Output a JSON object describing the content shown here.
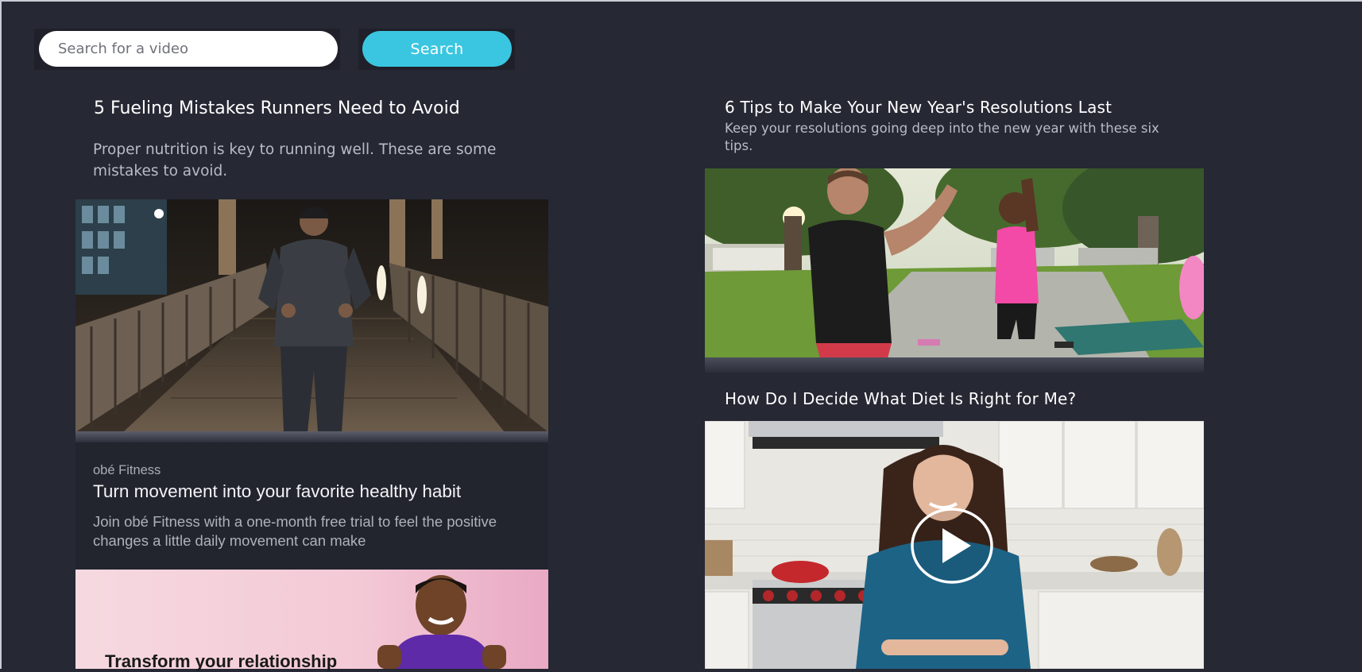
{
  "search": {
    "placeholder": "Search for a video",
    "button_label": "Search"
  },
  "articles": [
    {
      "title": "5 Fueling Mistakes Runners Need to Avoid",
      "description": "Proper nutrition is key to running well. These are some mistakes to avoid.",
      "image": "man-running-on-bridge-at-night"
    },
    {
      "title": "6 Tips to Make Your New Year's Resolutions Last",
      "description": "Keep your resolutions going deep into the new year with these six tips.",
      "image": "people-high-five-outdoors"
    },
    {
      "title": "How Do I Decide What Diet Is Right for Me?",
      "image": "woman-in-kitchen-video",
      "media_icon": "play-icon"
    }
  ],
  "ad": {
    "sponsor": "obé Fitness",
    "headline": "Turn movement into your favorite healthy habit",
    "body": "Join obé Fitness with a one-month free trial to feel the positive changes a little daily movement can make",
    "image_text": "Transform your relationship"
  },
  "colors": {
    "background": "#262834",
    "accent": "#3ac6e0"
  }
}
